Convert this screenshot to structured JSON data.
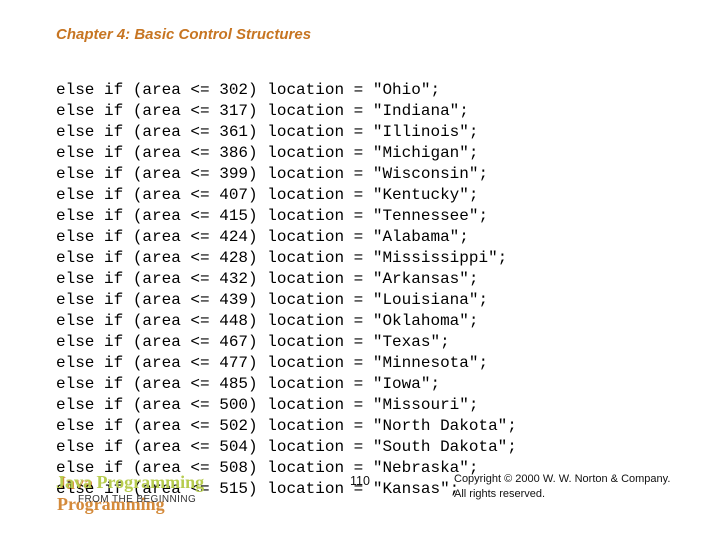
{
  "chapter_title": "Chapter 4: Basic Control Structures",
  "code": {
    "rows": [
      {
        "threshold": 302,
        "state": "Ohio"
      },
      {
        "threshold": 317,
        "state": "Indiana"
      },
      {
        "threshold": 361,
        "state": "Illinois"
      },
      {
        "threshold": 386,
        "state": "Michigan"
      },
      {
        "threshold": 399,
        "state": "Wisconsin"
      },
      {
        "threshold": 407,
        "state": "Kentucky"
      },
      {
        "threshold": 415,
        "state": "Tennessee"
      },
      {
        "threshold": 424,
        "state": "Alabama"
      },
      {
        "threshold": 428,
        "state": "Mississippi"
      },
      {
        "threshold": 432,
        "state": "Arkansas"
      },
      {
        "threshold": 439,
        "state": "Louisiana"
      },
      {
        "threshold": 448,
        "state": "Oklahoma"
      },
      {
        "threshold": 467,
        "state": "Texas"
      },
      {
        "threshold": 477,
        "state": "Minnesota"
      },
      {
        "threshold": 485,
        "state": "Iowa"
      },
      {
        "threshold": 500,
        "state": "Missouri"
      },
      {
        "threshold": 502,
        "state": "North Dakota"
      },
      {
        "threshold": 504,
        "state": "South Dakota"
      },
      {
        "threshold": 508,
        "state": "Nebraska"
      },
      {
        "threshold": 515,
        "state": "Kansas"
      }
    ]
  },
  "footer": {
    "book_title": "Java Programming",
    "book_sub": "FROM THE BEGINNING",
    "page_number": "110",
    "copyright_line1": "Copyright © 2000 W. W. Norton & Company.",
    "copyright_line2": "All rights reserved."
  }
}
